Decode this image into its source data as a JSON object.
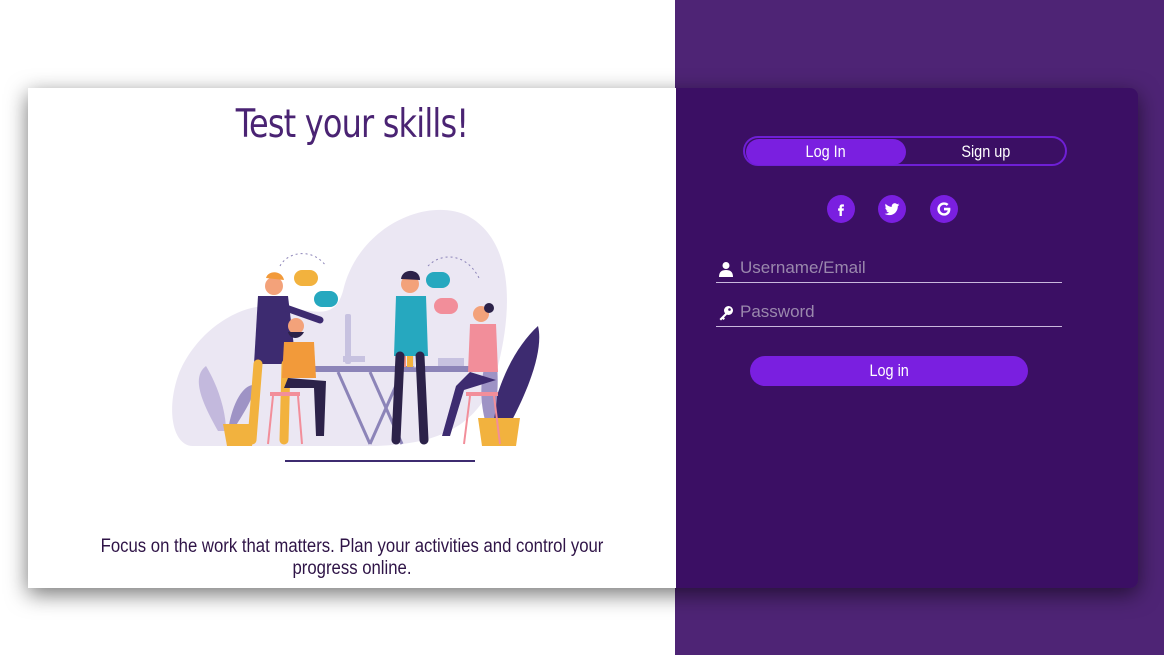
{
  "hero": {
    "title": "Test your skills!",
    "tagline": "Focus on the work that matters. Plan your activities and control your progress online."
  },
  "auth": {
    "tabs": [
      {
        "label": "Log In",
        "active": true
      },
      {
        "label": "Sign up",
        "active": false
      }
    ],
    "social": [
      {
        "icon": "facebook-icon"
      },
      {
        "icon": "twitter-icon"
      },
      {
        "icon": "google-icon"
      }
    ],
    "username": {
      "placeholder": "Username/Email",
      "value": "",
      "icon": "user-icon"
    },
    "password": {
      "placeholder": "Password",
      "value": "",
      "icon": "key-icon"
    },
    "submit_label": "Log in"
  },
  "colors": {
    "accent": "#7a1fe0",
    "panel": "#3b0f64",
    "page_right": "#4e2475",
    "title": "#4a2373"
  }
}
